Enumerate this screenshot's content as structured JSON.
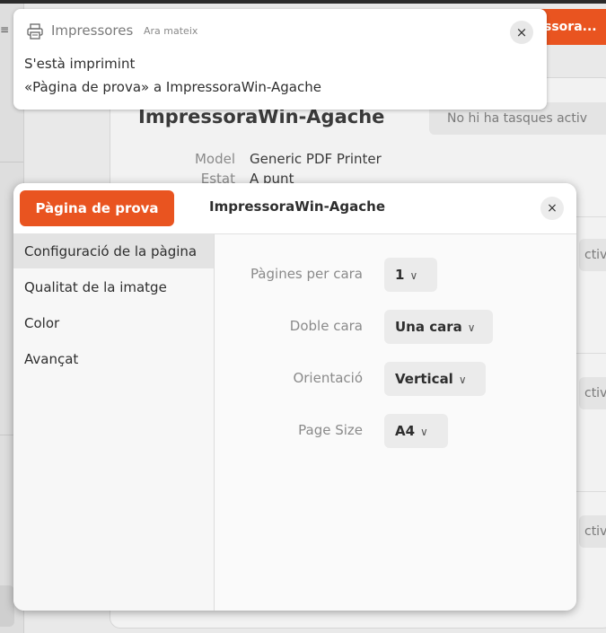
{
  "background": {
    "hamburger_icon": "≡",
    "add_printer_button": "ssora...",
    "printer_name": "ImpressoraWin-Agache",
    "jobs_status": "No hi ha tasques activ",
    "jobs_status_short": "ctiv",
    "model_label": "Model",
    "model_value": "Generic PDF Printer",
    "state_label": "Estat",
    "state_value": "A punt"
  },
  "notification": {
    "app_name": "Impressores",
    "time": "Ara mateix",
    "title": "S'està imprimint",
    "body": "«Pàgina de prova» a ImpressoraWin-Agache",
    "close_icon": "×"
  },
  "dialog": {
    "test_page_button": "Pàgina de prova",
    "title": "ImpressoraWin-Agache",
    "close_icon": "×",
    "sidebar": {
      "items": [
        {
          "label": "Configuració de la pàgina",
          "selected": true
        },
        {
          "label": "Qualitat de la imatge",
          "selected": false
        },
        {
          "label": "Color",
          "selected": false
        },
        {
          "label": "Avançat",
          "selected": false
        }
      ]
    },
    "settings": {
      "pages_per_side": {
        "label": "Pàgines per cara",
        "value": "1"
      },
      "two_sided": {
        "label": "Doble cara",
        "value": "Una cara"
      },
      "orientation": {
        "label": "Orientació",
        "value": "Vertical"
      },
      "page_size": {
        "label": "Page Size",
        "value": "A4"
      }
    },
    "chevron_icon": "∨"
  },
  "colors": {
    "accent": "#e95420",
    "window_bg": "#fafafa",
    "selected_item": "#e3e3e3"
  }
}
